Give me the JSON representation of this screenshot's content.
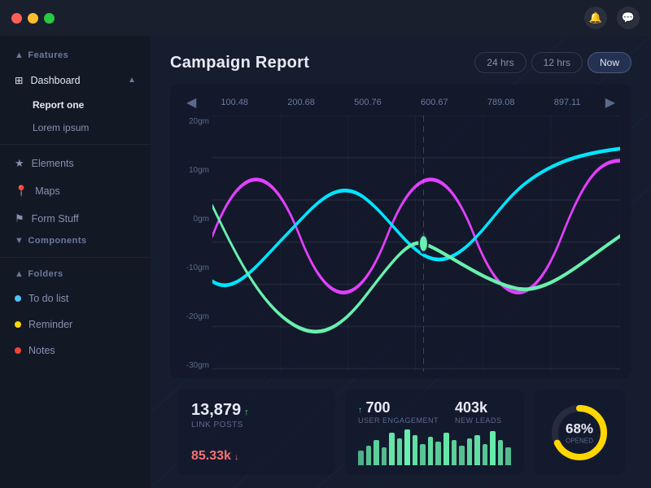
{
  "titlebar": {
    "traffic_lights": [
      "red",
      "yellow",
      "green"
    ],
    "icons": [
      "bell-icon",
      "chat-icon"
    ]
  },
  "sidebar": {
    "features_label": "Features",
    "dashboard_label": "Dashboard",
    "report_one_label": "Report one",
    "lorem_ipsum_label": "Lorem ipsum",
    "elements_label": "Elements",
    "maps_label": "Maps",
    "form_stuff_label": "Form Stuff",
    "components_label": "Components",
    "folders_label": "Folders",
    "todo_label": "To do list",
    "reminder_label": "Reminder",
    "notes_label": "Notes"
  },
  "main": {
    "title": "Campaign Report",
    "time_filters": [
      "24 hrs",
      "12 hrs",
      "Now"
    ],
    "active_filter": "Now",
    "chart": {
      "nav_labels": [
        "100.48",
        "200.68",
        "500.76",
        "600.67",
        "789.08",
        "897.11"
      ],
      "y_labels": [
        "20gm",
        "10gm",
        "0gm",
        "-10gm",
        "-20gm",
        "-30gm"
      ]
    },
    "stats": {
      "card1": {
        "main_value": "13,879",
        "main_up": "↑",
        "main_label": "LINK POSTS",
        "secondary_value": "85.33k",
        "secondary_icon": "↓"
      },
      "card2": {
        "engagement_value": "↑700",
        "engagement_label": "USER ENGAGEMENT",
        "leads_value": "403k",
        "leads_label": "NEW LEADS"
      },
      "card3": {
        "percent": "68%",
        "label": "OPENED"
      }
    }
  }
}
